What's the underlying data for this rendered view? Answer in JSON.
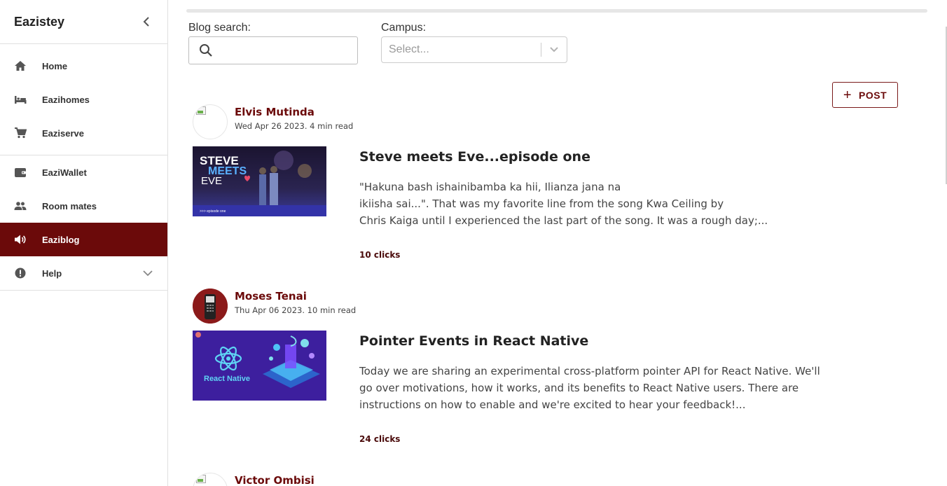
{
  "sidebar": {
    "title": "Eazistey",
    "groups": [
      [
        {
          "label": "Home",
          "icon": "home-icon"
        },
        {
          "label": "Eazihomes",
          "icon": "bed-icon"
        },
        {
          "label": "Eaziserve",
          "icon": "cart-icon"
        }
      ],
      [
        {
          "label": "EaziWallet",
          "icon": "wallet-icon"
        },
        {
          "label": "Room mates",
          "icon": "people-icon"
        },
        {
          "label": "Eaziblog",
          "icon": "megaphone-icon",
          "active": true
        },
        {
          "label": "Help",
          "icon": "alert-icon",
          "expandable": true
        }
      ]
    ]
  },
  "filters": {
    "search_label": "Blog search:",
    "search_value": "",
    "campus_label": "Campus:",
    "campus_placeholder": "Select..."
  },
  "post_button": {
    "label": "POST"
  },
  "posts": [
    {
      "author": "Elvis Mutinda",
      "date": "Wed Apr 26 2023. 4 min read",
      "title": "Steve meets Eve...episode one",
      "excerpt_lines": [
        "\"Hakuna bash ishainibamba ka hii, Ilianza jana na",
        "ikiisha sai...\". That was my favorite line from the song Kwa Ceiling by",
        "Chris Kaiga until I experienced the last part of the song. It was a rough day;..."
      ],
      "clicks": "10 clicks",
      "thumb_text": {
        "line1": "STEVE",
        "line2": "MEETS",
        "line3": "EVE",
        "footer": ">>> episode one"
      }
    },
    {
      "author": "Moses Tenai",
      "date": "Thu Apr 06 2023. 10 min read",
      "title": "Pointer Events in React Native",
      "excerpt_lines": [
        "Today we are sharing an experimental cross-platform pointer API for React Native. We'll",
        "go over motivations, how it works, and its benefits to React Native users. There are",
        "instructions on how to enable and we're excited to hear your feedback!..."
      ],
      "clicks": "24 clicks",
      "thumb_text": {
        "label": "React Native"
      }
    },
    {
      "author": "Victor Ombisi"
    }
  ],
  "colors": {
    "accent": "#6b0a0a",
    "react_bg": "#3d1f9e"
  }
}
